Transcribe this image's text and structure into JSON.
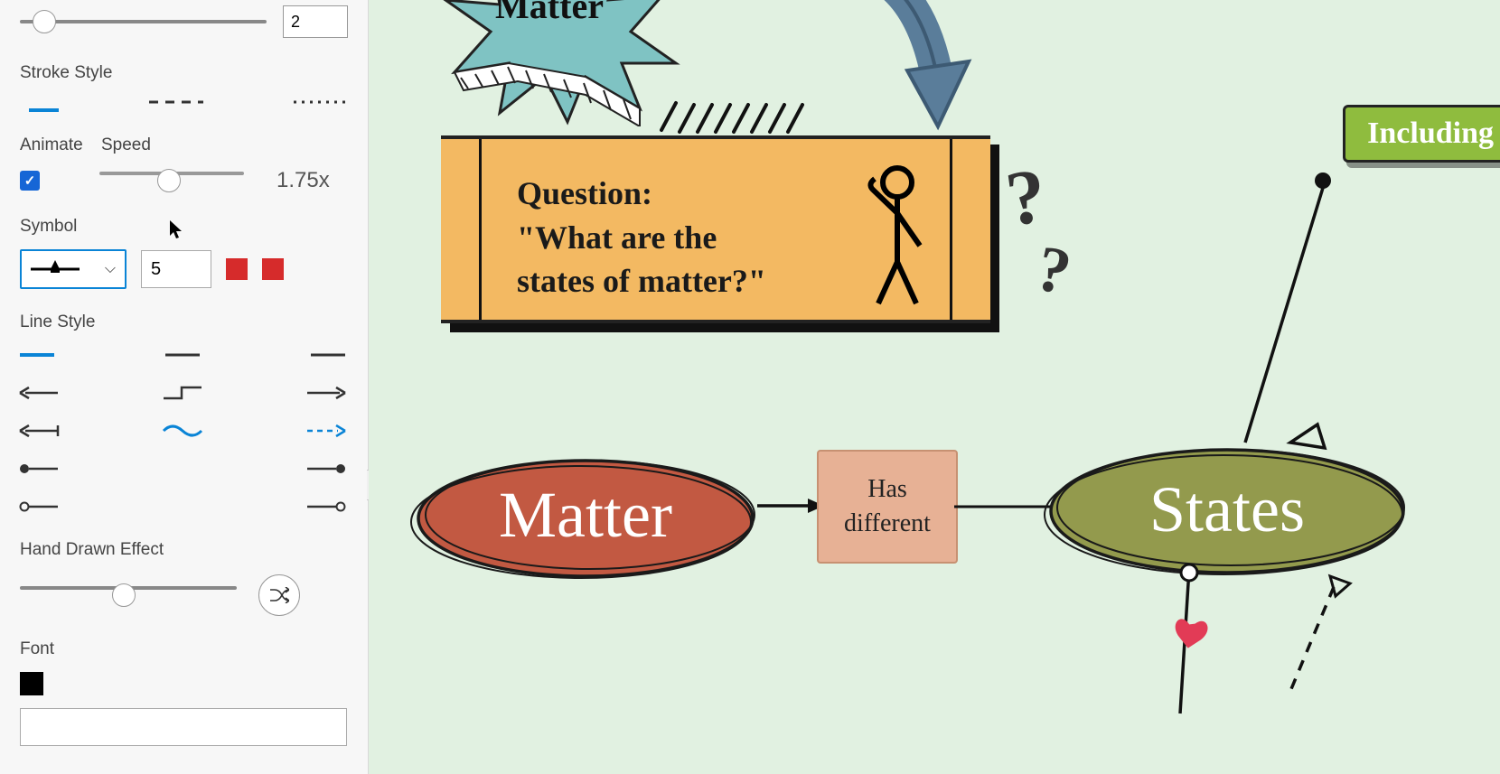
{
  "sidebar": {
    "stroke_width_value": "2",
    "stroke_style_label": "Stroke Style",
    "animate_label": "Animate",
    "speed_label": "Speed",
    "animate_checked": true,
    "speed_value": "1.75x",
    "symbol_label": "Symbol",
    "symbol_size": "5",
    "line_style_label": "Line Style",
    "hand_drawn_label": "Hand Drawn Effect",
    "font_label": "Font"
  },
  "canvas": {
    "starburst_text": "Matter",
    "question_line1": "Question:",
    "question_line2": "\"What are the",
    "question_line3": "states of matter?\"",
    "including_label": "Including",
    "node_matter": "Matter",
    "node_states": "States",
    "has_different_line1": "Has",
    "has_different_line2": "different"
  }
}
